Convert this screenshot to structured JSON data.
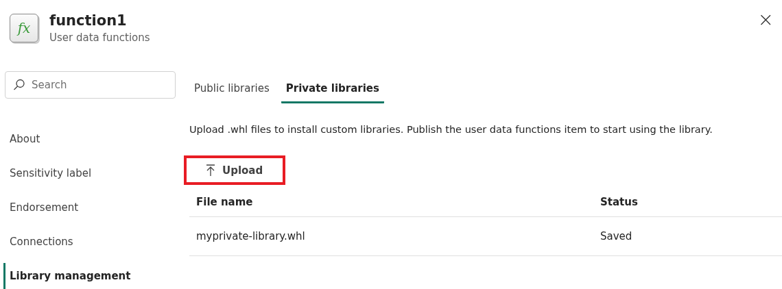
{
  "header": {
    "icon_label": "fx",
    "title": "function1",
    "subtitle": "User data functions",
    "close": "×"
  },
  "search": {
    "placeholder": "Search"
  },
  "sidebar": {
    "items": [
      {
        "label": "About",
        "selected": false
      },
      {
        "label": "Sensitivity label",
        "selected": false
      },
      {
        "label": "Endorsement",
        "selected": false
      },
      {
        "label": "Connections",
        "selected": false
      },
      {
        "label": "Library management",
        "selected": true
      }
    ]
  },
  "tabs": [
    {
      "label": "Public libraries",
      "selected": false
    },
    {
      "label": "Private libraries",
      "selected": true
    }
  ],
  "description": "Upload .whl files to install custom libraries. Publish the user data functions item to start using the library.",
  "upload": {
    "label": "Upload",
    "highlighted": true
  },
  "table": {
    "columns": [
      "File name",
      "Status"
    ],
    "rows": [
      [
        "myprivate-library.whl",
        "Saved"
      ]
    ]
  }
}
